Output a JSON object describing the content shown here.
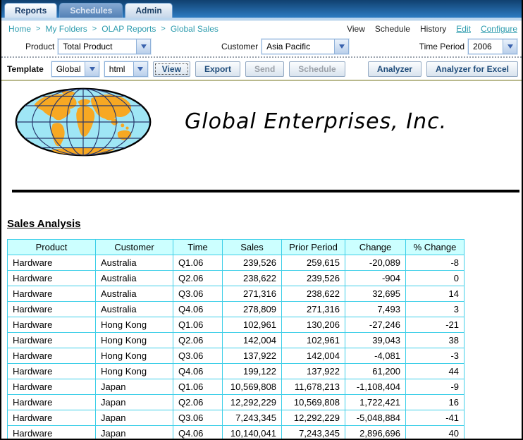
{
  "tabs": [
    {
      "label": "Reports",
      "state": "active"
    },
    {
      "label": "Schedules",
      "state": "inactive-blue"
    },
    {
      "label": "Admin",
      "state": "inactive-light"
    }
  ],
  "breadcrumb": {
    "separator": ">",
    "items": [
      "Home",
      "My Folders",
      "OLAP Reports",
      "Global Sales"
    ]
  },
  "actions": {
    "plain": [
      "View",
      "Schedule",
      "History"
    ],
    "links": [
      "Edit",
      "Configure"
    ]
  },
  "parameters": {
    "product": {
      "label": "Product",
      "value": "Total Product"
    },
    "customer": {
      "label": "Customer",
      "value": "Asia Pacific"
    },
    "time_period": {
      "label": "Time Period",
      "value": "2006"
    }
  },
  "template_bar": {
    "label": "Template",
    "template_value": "Global",
    "format_value": "html",
    "buttons": [
      {
        "label": "View",
        "enabled": true,
        "focused": true
      },
      {
        "label": "Export",
        "enabled": true,
        "focused": false
      },
      {
        "label": "Send",
        "enabled": false,
        "focused": false
      },
      {
        "label": "Schedule",
        "enabled": false,
        "focused": false
      }
    ],
    "analyzer_buttons": [
      {
        "label": "Analyzer"
      },
      {
        "label": "Analyzer for Excel"
      }
    ]
  },
  "company": {
    "name": "Global Enterprises, Inc."
  },
  "report": {
    "title": "Sales Analysis",
    "columns": [
      "Product",
      "Customer",
      "Time",
      "Sales",
      "Prior Period",
      "Change",
      "% Change"
    ],
    "rows": [
      [
        "Hardware",
        "Australia",
        "Q1.06",
        "239,526",
        "259,615",
        "-20,089",
        "-8"
      ],
      [
        "Hardware",
        "Australia",
        "Q2.06",
        "238,622",
        "239,526",
        "-904",
        "0"
      ],
      [
        "Hardware",
        "Australia",
        "Q3.06",
        "271,316",
        "238,622",
        "32,695",
        "14"
      ],
      [
        "Hardware",
        "Australia",
        "Q4.06",
        "278,809",
        "271,316",
        "7,493",
        "3"
      ],
      [
        "Hardware",
        "Hong Kong",
        "Q1.06",
        "102,961",
        "130,206",
        "-27,246",
        "-21"
      ],
      [
        "Hardware",
        "Hong Kong",
        "Q2.06",
        "142,004",
        "102,961",
        "39,043",
        "38"
      ],
      [
        "Hardware",
        "Hong Kong",
        "Q3.06",
        "137,922",
        "142,004",
        "-4,081",
        "-3"
      ],
      [
        "Hardware",
        "Hong Kong",
        "Q4.06",
        "199,122",
        "137,922",
        "61,200",
        "44"
      ],
      [
        "Hardware",
        "Japan",
        "Q1.06",
        "10,569,808",
        "11,678,213",
        "-1,108,404",
        "-9"
      ],
      [
        "Hardware",
        "Japan",
        "Q2.06",
        "12,292,229",
        "10,569,808",
        "1,722,421",
        "16"
      ],
      [
        "Hardware",
        "Japan",
        "Q3.06",
        "7,243,345",
        "12,292,229",
        "-5,048,884",
        "-41"
      ],
      [
        "Hardware",
        "Japan",
        "Q4.06",
        "10,140,041",
        "7,243,345",
        "2,896,696",
        "40"
      ]
    ]
  },
  "colors": {
    "tabbar_top": "#10406f",
    "tabbar_bottom": "#2e7cc2",
    "breadcrumb_teal": "#2e9cae",
    "table_border_cyan": "#3ecfe8",
    "table_header_bg": "#ccffff",
    "globe_ocean": "#9fe6f5",
    "globe_land": "#f7a823"
  }
}
